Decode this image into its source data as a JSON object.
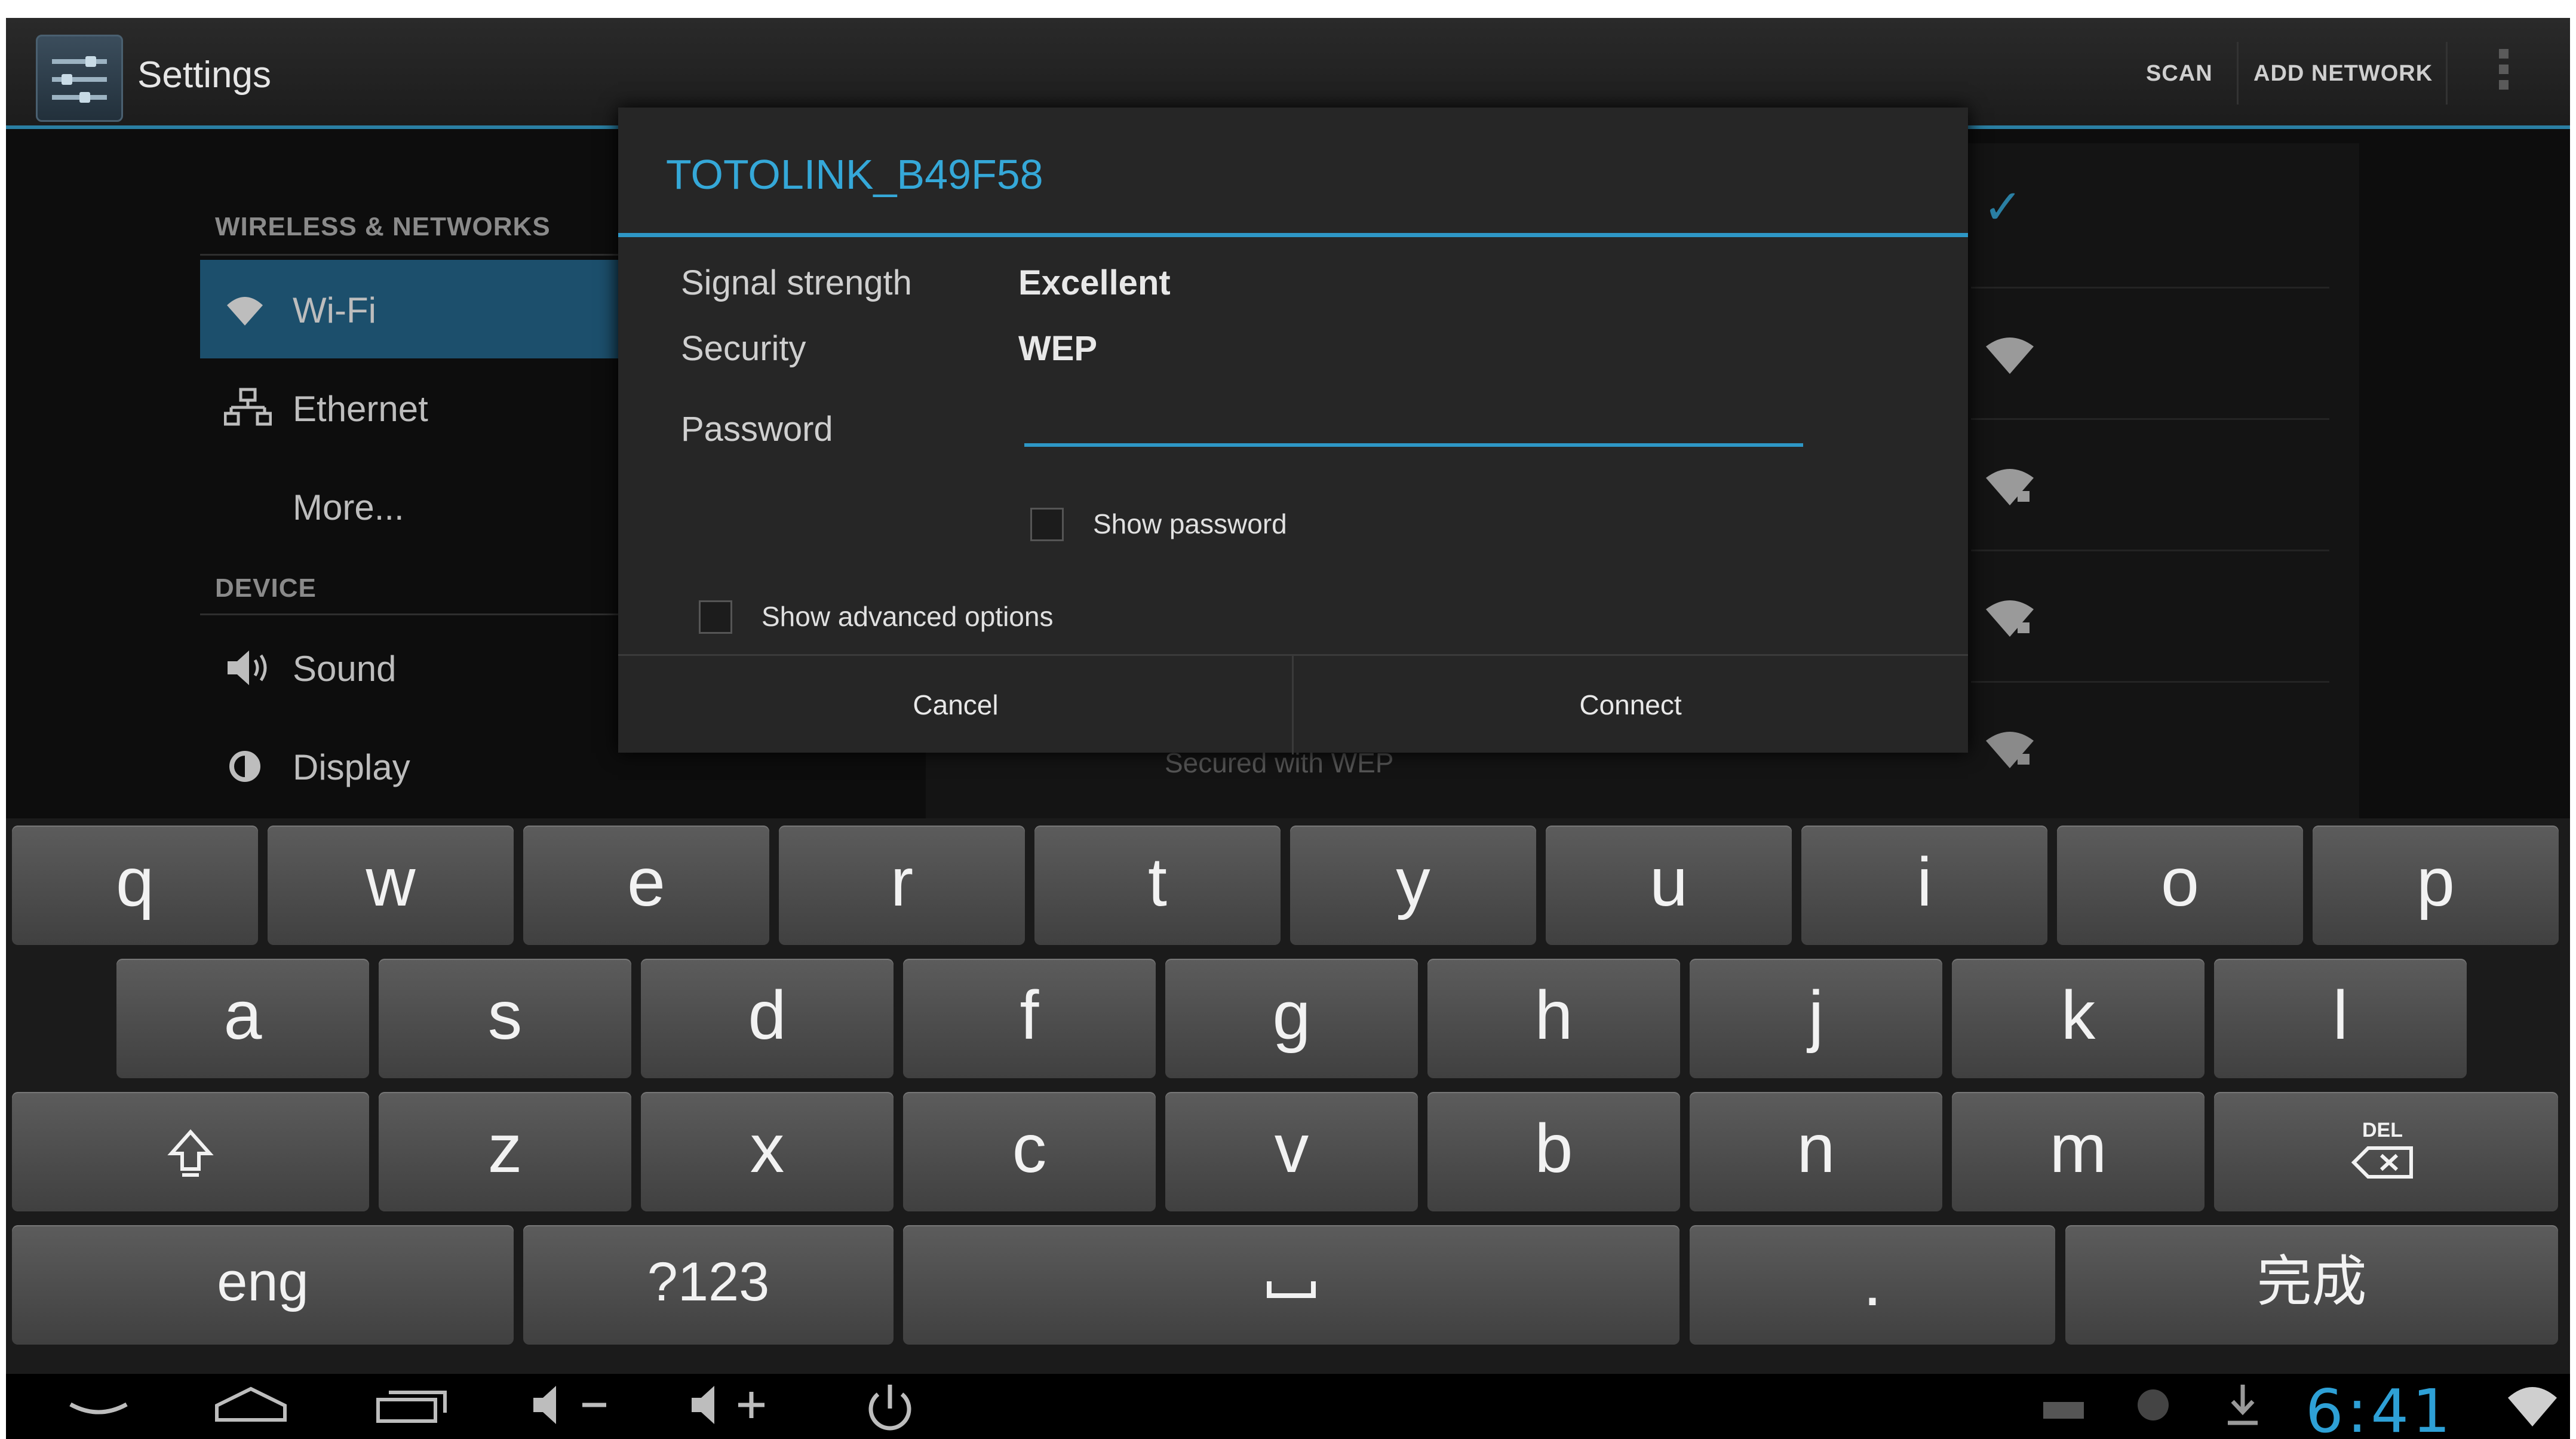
{
  "action_bar": {
    "title": "Settings",
    "actions": [
      "SCAN",
      "ADD NETWORK"
    ]
  },
  "sidebar": {
    "sections": [
      {
        "header": "WIRELESS & NETWORKS",
        "items": [
          {
            "label": "Wi-Fi",
            "icon": "wifi-icon",
            "active": true
          },
          {
            "label": "Ethernet",
            "icon": "ethernet-icon",
            "active": false
          },
          {
            "label": "More...",
            "icon": "",
            "active": false
          }
        ]
      },
      {
        "header": "DEVICE",
        "items": [
          {
            "label": "Sound",
            "icon": "speaker-icon",
            "active": false
          },
          {
            "label": "Display",
            "icon": "brightness-icon",
            "active": false
          }
        ]
      }
    ]
  },
  "wifi_list": {
    "peek_text": "Secured with WEP"
  },
  "dialog": {
    "title": "TOTOLINK_B49F58",
    "signal_label": "Signal strength",
    "signal_value": "Excellent",
    "security_label": "Security",
    "security_value": "WEP",
    "password_label": "Password",
    "password_value": "",
    "show_password_label": "Show password",
    "show_password_checked": false,
    "advanced_label": "Show advanced options",
    "advanced_checked": false,
    "cancel_label": "Cancel",
    "connect_label": "Connect"
  },
  "keyboard": {
    "row1": [
      "q",
      "w",
      "e",
      "r",
      "t",
      "y",
      "u",
      "i",
      "o",
      "p"
    ],
    "row2": [
      "a",
      "s",
      "d",
      "f",
      "g",
      "h",
      "j",
      "k",
      "l"
    ],
    "row3": [
      "z",
      "x",
      "c",
      "v",
      "b",
      "n",
      "m"
    ],
    "lang_key": "eng",
    "symbols_key": "?123",
    "period_key": ".",
    "done_key": "完成",
    "delete_key_label": "DEL"
  },
  "status_bar": {
    "time": "6:41"
  },
  "colors": {
    "accent": "#2e97c6",
    "title_accent": "#35a8d8",
    "active_item": "#1c4f6c"
  }
}
